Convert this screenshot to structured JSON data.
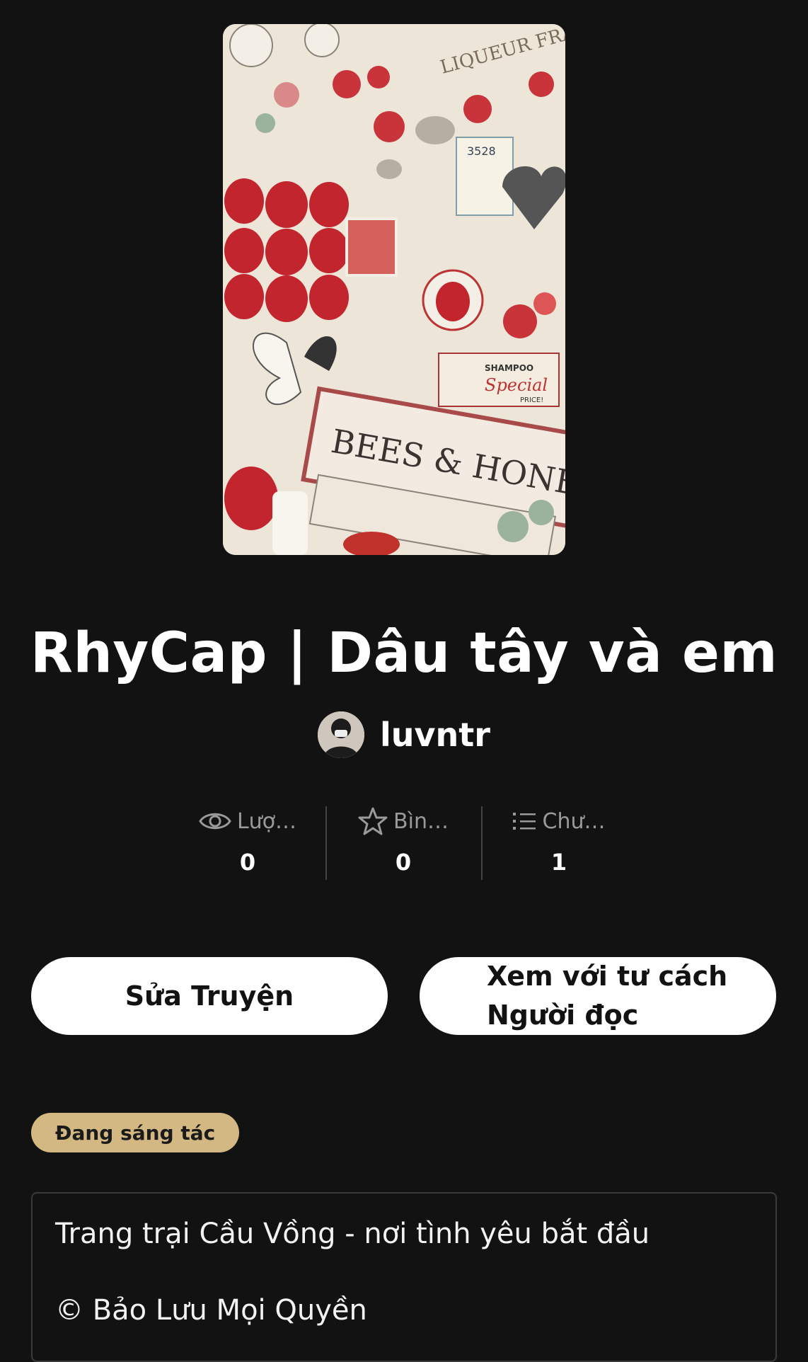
{
  "story": {
    "title": "RhyCap | Dâu tây và em",
    "author": "luvntr"
  },
  "stats": [
    {
      "icon": "eye-icon",
      "label": "Lượ…",
      "value": "0"
    },
    {
      "icon": "star-icon",
      "label": "Bìn…",
      "value": "0"
    },
    {
      "icon": "list-icon",
      "label": "Chư…",
      "value": "1"
    }
  ],
  "buttons": {
    "edit": "Sửa Truyện",
    "view_line1": "Xem với tư cách",
    "view_line2": "Người đọc"
  },
  "status_badge": "Đang sáng tác",
  "description": {
    "line1": "Trang trại Cầu Vồng - nơi tình yêu bắt đầu",
    "line2": "© Bảo Lưu Mọi Quyền"
  },
  "cover_text": {
    "liqueur": "LIQUEUR FRAISE",
    "bees": "BEES & HONEY",
    "special": "Special",
    "shampoo": "SHAMPOO",
    "price": "PRICE!",
    "number": "3528"
  },
  "colors": {
    "background": "#121212",
    "badge": "#d4b883",
    "button": "#ffffff"
  }
}
